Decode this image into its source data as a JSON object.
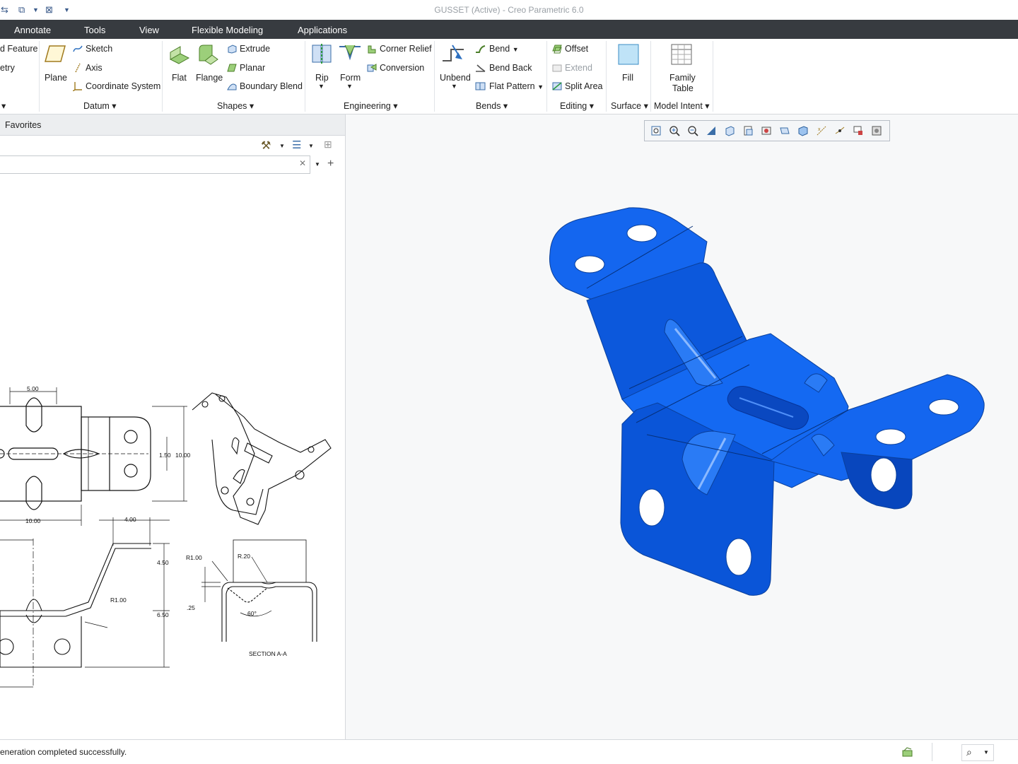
{
  "window": {
    "title": "GUSSET (Active) - Creo Parametric 6.0"
  },
  "tabs": [
    "Annotate",
    "Tools",
    "View",
    "Flexible Modeling",
    "Applications"
  ],
  "ribbon": {
    "model": {
      "feature_label": "d Feature",
      "geometry_label": "etry"
    },
    "datum": {
      "plane": "Plane",
      "sketch": "Sketch",
      "axis": "Axis",
      "coord": "Coordinate System",
      "group": "Datum"
    },
    "shapes": {
      "flat": "Flat",
      "flange": "Flange",
      "extrude": "Extrude",
      "planar": "Planar",
      "boundary_blend": "Boundary Blend",
      "group": "Shapes"
    },
    "engineering": {
      "rip": "Rip",
      "form": "Form",
      "corner_relief": "Corner Relief",
      "conversion": "Conversion",
      "group": "Engineering"
    },
    "bends": {
      "unbend": "Unbend",
      "bend": "Bend",
      "bend_back": "Bend Back",
      "flat_pattern": "Flat Pattern",
      "group": "Bends"
    },
    "editing": {
      "offset": "Offset",
      "extend": "Extend",
      "split_area": "Split Area",
      "group": "Editing"
    },
    "surface": {
      "fill": "Fill",
      "group": "Surface"
    },
    "model_intent": {
      "family_table_1": "Family",
      "family_table_2": "Table",
      "group": "Model Intent"
    }
  },
  "left_panel": {
    "favorites": "Favorites",
    "search_placeholder": ""
  },
  "drawing": {
    "dims": {
      "d500": "5.00",
      "d150": "1.50",
      "d1000a": "10.00",
      "d1000b": "10.00",
      "d400": "4.00",
      "d450": "4.50",
      "d650": "6.50",
      "r100a": "R1.00",
      "r100b": "R1.00",
      "r020": "R.20",
      "d025": ".25",
      "a60": "60°"
    },
    "section_label": "SECTION  A-A"
  },
  "status": {
    "message": "eneration completed successfully."
  },
  "colors": {
    "part": "#0a5ce6",
    "part_dark": "#0646b8",
    "ribbon_tabs": "#373b40"
  }
}
